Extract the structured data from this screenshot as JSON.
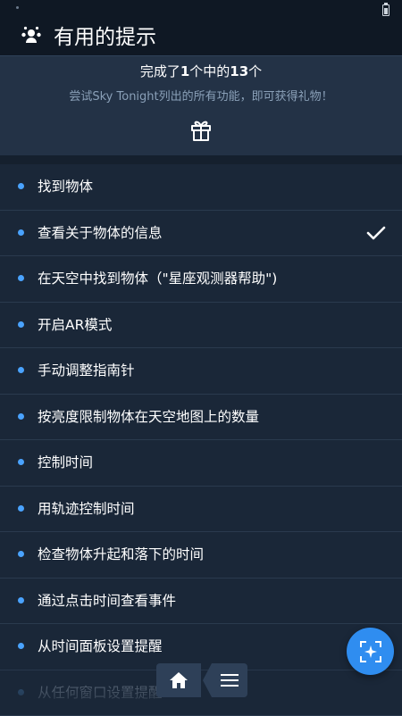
{
  "header": {
    "title": "有用的提示",
    "icon": "people-icon"
  },
  "progress": {
    "prefix": "完成了",
    "done": "1",
    "middle": "个中的",
    "total": "13",
    "suffix": "个",
    "subtitle": "尝试Sky Tonight列出的所有功能，即可获得礼物！",
    "icon": "gift-icon"
  },
  "tips": [
    {
      "label": "找到物体",
      "checked": false
    },
    {
      "label": "查看关于物体的信息",
      "checked": true
    },
    {
      "label": "在天空中找到物体（\"星座观测器帮助\")",
      "checked": false
    },
    {
      "label": "开启AR模式",
      "checked": false
    },
    {
      "label": "手动调整指南针",
      "checked": false
    },
    {
      "label": "按亮度限制物体在天空地图上的数量",
      "checked": false
    },
    {
      "label": "控制时间",
      "checked": false
    },
    {
      "label": "用轨迹控制时间",
      "checked": false
    },
    {
      "label": "检查物体升起和落下的时间",
      "checked": false
    },
    {
      "label": "通过点击时间查看事件",
      "checked": false
    },
    {
      "label": "从时间面板设置提醒",
      "checked": false
    },
    {
      "label": "从任何窗口设置提醒",
      "checked": false
    }
  ],
  "nav": {
    "home_icon": "home-icon",
    "menu_icon": "menu-icon",
    "fab_icon": "sparkle-icon"
  },
  "colors": {
    "background": "#1a2738",
    "accent": "#4aa3ff",
    "fab": "#2f8df0"
  }
}
